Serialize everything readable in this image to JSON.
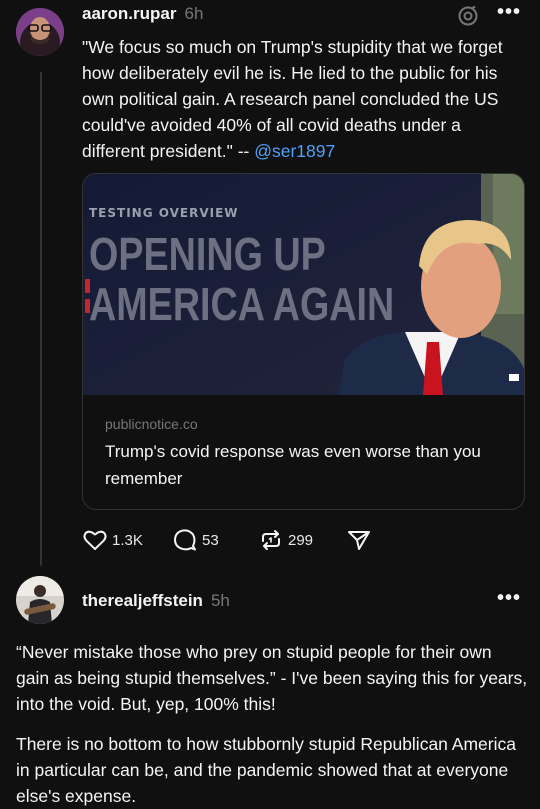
{
  "posts": [
    {
      "username": "aaron.rupar",
      "time": "6h",
      "text": "\"We focus so much on Trump's stupidity that we forget how deliberately evil he is. He lied to the public for his own political gain. A research panel concluded the US could've avoided 40% of all covid deaths under a different president.\" -- ",
      "mention": "@ser1897",
      "link_card": {
        "image_kicker": "TESTING OVERVIEW",
        "image_headline_1": "OPENING UP",
        "image_headline_2": "AMERICA AGAIN",
        "domain": "publicnotice.co",
        "title": "Trump's covid response was even worse than you remember"
      },
      "actions": {
        "likes": "1.3K",
        "replies": "53",
        "reposts": "299"
      }
    },
    {
      "username": "therealjeffstein",
      "time": "5h",
      "paragraph1": "“Never mistake those who prey on stupid people for their own gain as being stupid themselves.” - I've been saying this for years, into the void. But, yep, 100% this!",
      "paragraph2": "There is no bottom to how stubbornly stupid Republican America in particular can be, and the pandemic showed that at everyone else's expense."
    }
  ],
  "icons": {
    "more": "more-horizontal-icon",
    "threads": "threads-logo-icon",
    "like": "heart-icon",
    "reply": "comment-icon",
    "repost": "repost-icon",
    "share": "send-icon"
  },
  "colors": {
    "background": "#101010",
    "mention": "#4ea2f7",
    "muted": "#777777"
  }
}
